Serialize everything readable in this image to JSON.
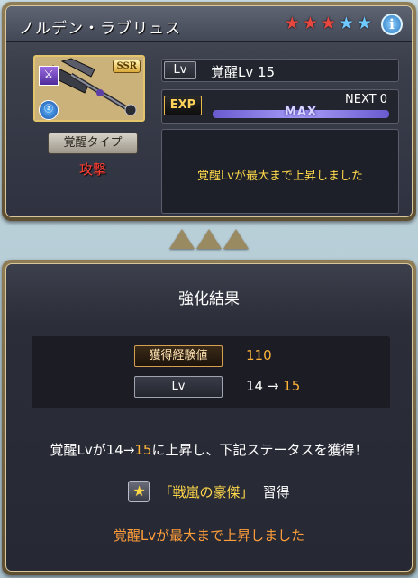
{
  "header": {
    "weapon_name": "ノルデン・ラブリュス",
    "stars": [
      "red",
      "red",
      "red",
      "blue",
      "blue"
    ],
    "info_icon": "i"
  },
  "weapon": {
    "rarity_badge": "SSR",
    "element_icon_1": "⚔",
    "element_icon_2": "ⓐ"
  },
  "awakening_type": {
    "button_label": "覚醒タイプ",
    "value": "攻撃",
    "value_color": "#ff3c32"
  },
  "level": {
    "label": "Lv",
    "value": "覚醒Lv 15"
  },
  "exp": {
    "label": "EXP",
    "next_text": "NEXT 0",
    "max_text": "MAX",
    "progress": 1.0
  },
  "message_box": {
    "text": "覚醒Lvが最大まで上昇しました"
  },
  "result": {
    "title": "強化結果",
    "exp_label": "獲得経験値",
    "exp_value": "110",
    "lv_label": "Lv",
    "lv_from": "14",
    "lv_arrow": "→",
    "lv_to": "15",
    "sentence_prefix": "覚醒Lvが",
    "sentence_from": "14",
    "sentence_arrow": "→",
    "sentence_to": "15",
    "sentence_suffix": "に上昇し、下記ステータスを獲得！",
    "skill_name": "「戦嵐の豪傑」",
    "skill_suffix": "習得",
    "skill_icon": "★",
    "final_message": "覚醒Lvが最大まで上昇しました"
  },
  "colors": {
    "accent_gold": "#ffb43a",
    "message_yellow": "#ffd84a",
    "final_orange": "#ff9e3a",
    "star_red": "#e8473f",
    "star_blue": "#6fc8ff"
  }
}
